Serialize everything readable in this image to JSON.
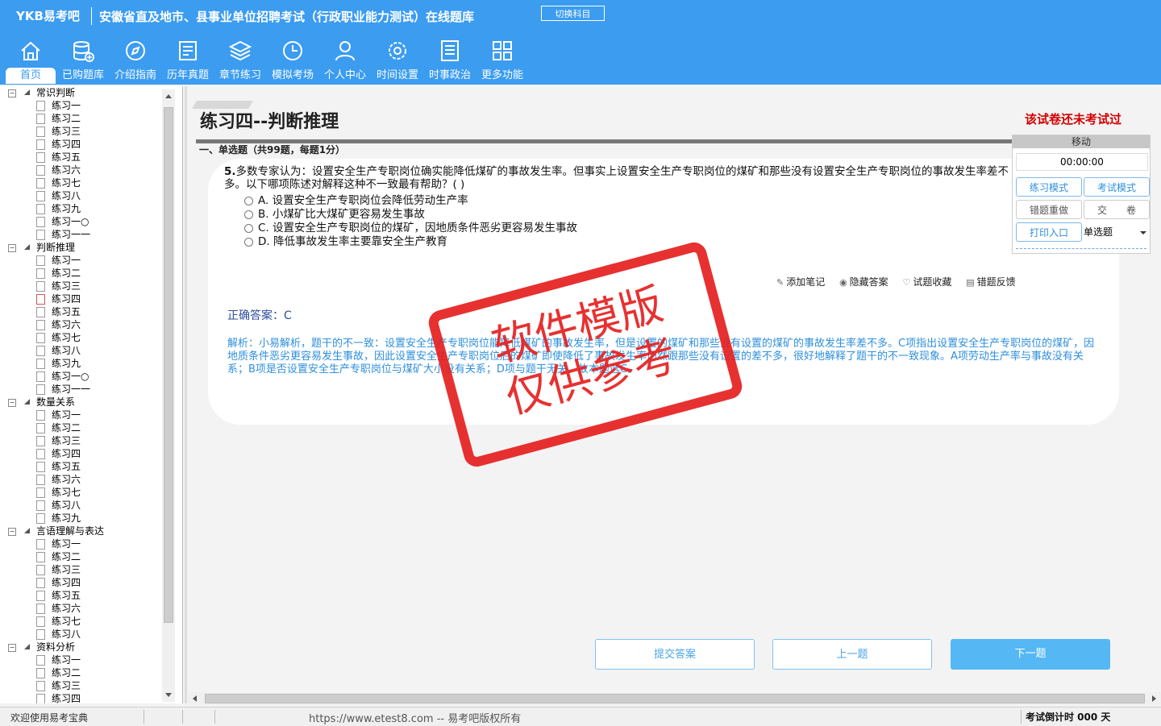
{
  "header": {
    "logo": "YKB易考吧",
    "app_title": "安徽省直及地市、县事业单位招聘考试（行政职业能力测试）在线题库",
    "switch_subject": "切换科目"
  },
  "nav": [
    {
      "label": "首页",
      "icon": "home-icon"
    },
    {
      "label": "已购题库",
      "icon": "database-icon"
    },
    {
      "label": "介绍指南",
      "icon": "compass-icon"
    },
    {
      "label": "历年真题",
      "icon": "document-list-icon"
    },
    {
      "label": "章节练习",
      "icon": "layers-icon"
    },
    {
      "label": "模拟考场",
      "icon": "clock-icon"
    },
    {
      "label": "个人中心",
      "icon": "user-icon"
    },
    {
      "label": "时间设置",
      "icon": "gear-icon"
    },
    {
      "label": "时事政治",
      "icon": "notebook-icon"
    },
    {
      "label": "更多功能",
      "icon": "grid-icon"
    }
  ],
  "tree": [
    {
      "group": "常识判断",
      "items": [
        "练习一",
        "练习二",
        "练习三",
        "练习四",
        "练习五",
        "练习六",
        "练习七",
        "练习八",
        "练习九",
        "练习一○",
        "练习一一"
      ]
    },
    {
      "group": "判断推理",
      "items": [
        "练习一",
        "练习二",
        "练习三",
        "练习四",
        "练习五",
        "练习六",
        "练习七",
        "练习八",
        "练习九",
        "练习一○",
        "练习一一"
      ]
    },
    {
      "group": "数量关系",
      "items": [
        "练习一",
        "练习二",
        "练习三",
        "练习四",
        "练习五",
        "练习六",
        "练习七",
        "练习八",
        "练习九"
      ]
    },
    {
      "group": "言语理解与表达",
      "items": [
        "练习一",
        "练习二",
        "练习三",
        "练习四",
        "练习五",
        "练习六",
        "练习七",
        "练习八"
      ]
    },
    {
      "group": "资料分析",
      "items": [
        "练习一",
        "练习二",
        "练习三",
        "练习四"
      ]
    }
  ],
  "main": {
    "paper_title": "练习四--判断推理",
    "status_note": "该试卷还未考试过",
    "section_title": "一、单选题（共99题，每题1分）",
    "question": {
      "number": "5.",
      "text": "多数专家认为：设置安全生产专职岗位确实能降低煤矿的事故发生率。但事实上设置安全生产专职岗位的煤矿和那些没有设置安全生产专职岗位的事故发生率差不多。以下哪项陈述对解释这种不一致最有帮助？( )",
      "options": [
        "A. 设置安全生产专职岗位会降低劳动生产率",
        "B. 小煤矿比大煤矿更容易发生事故",
        "C. 设置安全生产专职岗位的煤矿，因地质条件恶劣更容易发生事故",
        "D. 降低事故发生率主要靠安全生产教育"
      ]
    },
    "tools": {
      "add_note": "添加笔记",
      "hide_answer": "隐藏答案",
      "favorite": "试题收藏",
      "feedback": "错题反馈"
    },
    "answer": "正确答案：C",
    "analysis": "解析：小易解析，题干的不一致：设置安全生产专职岗位能降低煤矿的事故发生率，但是设置的煤矿和那些没有设置的煤矿的事故发生率差不多。C项指出设置安全生产专职岗位的煤矿，因地质条件恶劣更容易发生事故，因此设置安全生产专职岗位后的煤矿即使降低了事故发生率仍然跟那些没有设置的差不多，很好地解释了题干的不一致现象。A项劳动生产率与事故没有关系；B项是否设置安全生产专职岗位与煤矿大小没有关系；D项与题干无关。故本题选C。"
  },
  "control": {
    "move": "移动",
    "timer": "00:00:00",
    "practice_mode": "练习模式",
    "exam_mode": "考试模式",
    "redo_wrong": "错题重做",
    "submit_paper": "交　　卷",
    "print": "打印入口",
    "type_select": "单选题"
  },
  "buttons": {
    "submit_answer": "提交答案",
    "prev": "上一题",
    "next": "下一题"
  },
  "status": {
    "welcome": "欢迎使用易考宝典",
    "copyright": "https://www.etest8.com -- 易考吧版权所有",
    "countdown": "考试倒计时 000 天"
  },
  "watermark": {
    "line1": "软件模版",
    "line2": "仅供参考"
  },
  "colors": {
    "header_bg": "#3b9cf0",
    "status_red": "#d00000",
    "answer_blue": "#2d4d9b",
    "analysis_blue": "#2e8fdc",
    "stamp_red": "#e52020"
  }
}
